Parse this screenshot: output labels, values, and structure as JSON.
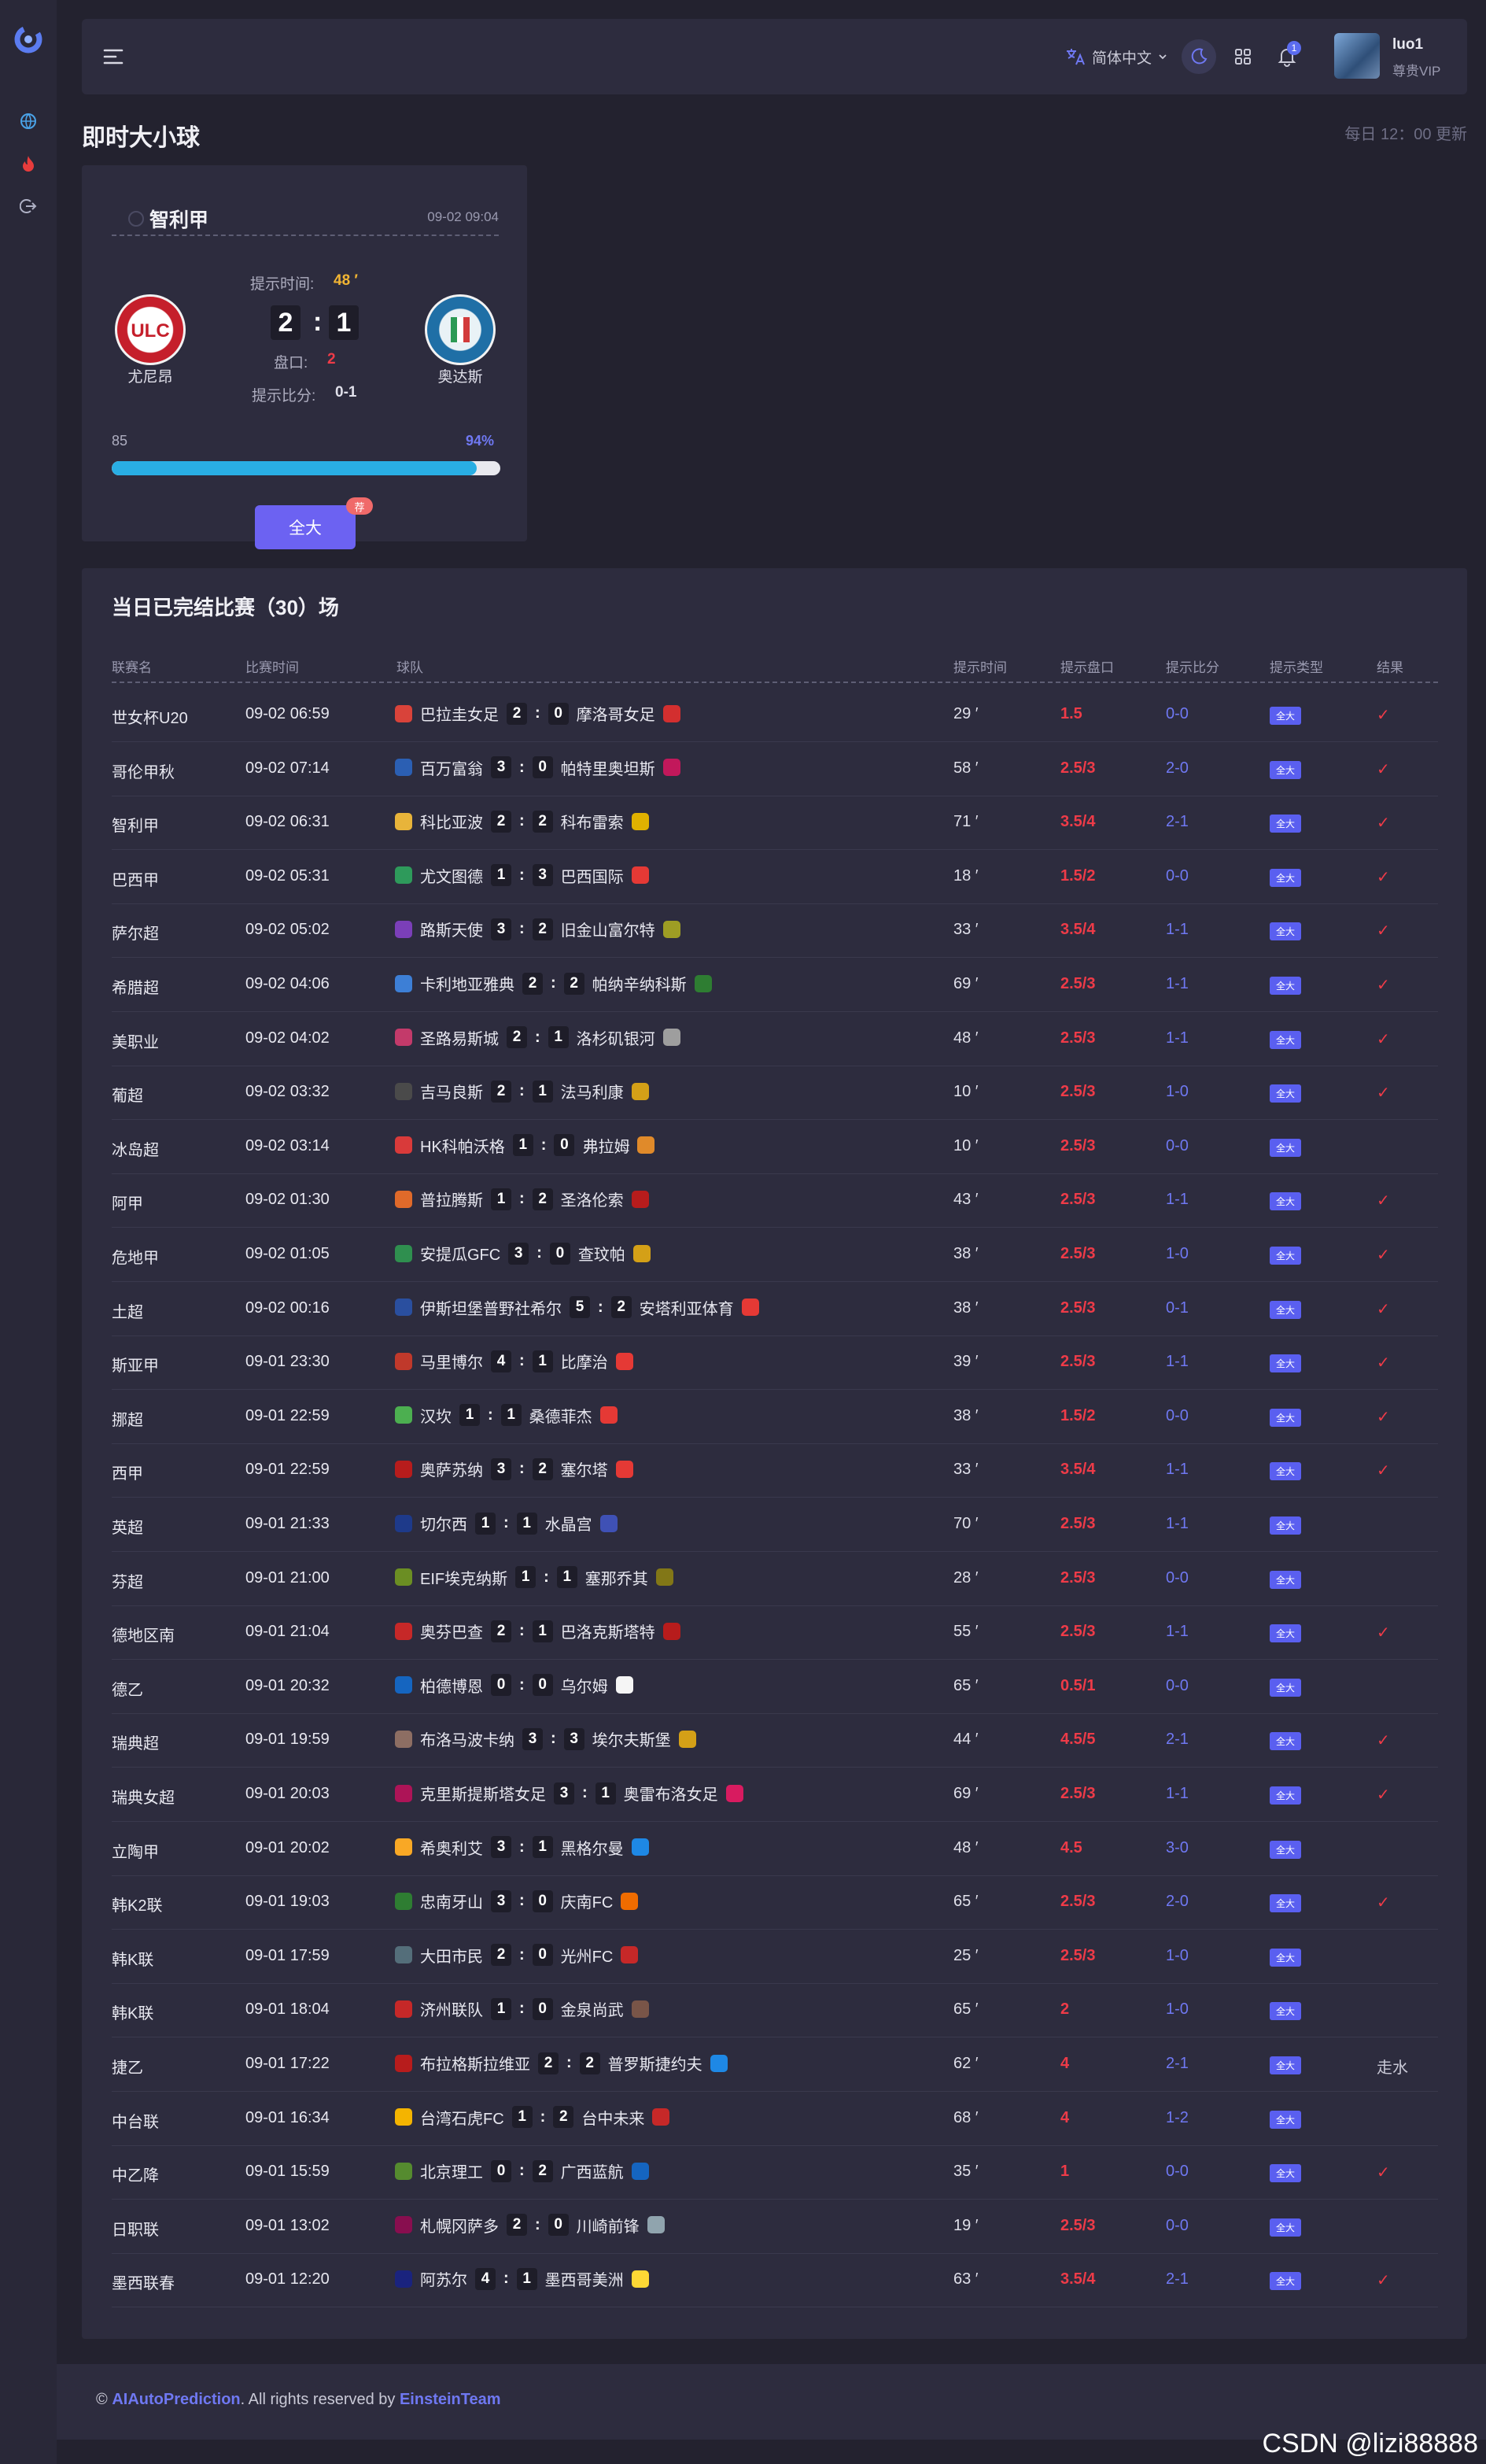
{
  "topbar": {
    "language": "简体中文",
    "notification_count": "1",
    "user_name": "luo1",
    "user_role": "尊贵VIP"
  },
  "page": {
    "title": "即时大小球",
    "update_note": "每日 12：00 更新"
  },
  "live_card": {
    "league": "智利甲",
    "datetime": "09-02 09:04",
    "home_team": "尤尼昂",
    "away_team": "奥达斯",
    "tip_time_label": "提示时间:",
    "tip_time_value": "48 ′",
    "home_score": "2",
    "away_score": "1",
    "handicap_label": "盘口:",
    "handicap_value": "2",
    "tip_score_label": "提示比分:",
    "tip_score_value": "0-1",
    "progress_left": "85",
    "progress_right": "94%",
    "progress_fraction": 0.94,
    "button_label": "全大",
    "badge_label": "荐"
  },
  "table": {
    "title": "当日已完结比赛（30）场",
    "headers": {
      "league": "联赛名",
      "time": "比赛时间",
      "teams": "球队",
      "tip_time": "提示时间",
      "tip_line": "提示盘口",
      "tip_score": "提示比分",
      "tip_type": "提示类型",
      "result": "结果"
    },
    "rows": [
      {
        "league": "世女杯U20",
        "time": "09-02 06:59",
        "home": "巴拉圭女足",
        "hs": "2",
        "as": "0",
        "away": "摩洛哥女足",
        "min": "29 ′",
        "line": "1.5",
        "tscore": "0-0",
        "type": "全大",
        "result": "✓"
      },
      {
        "league": "哥伦甲秋",
        "time": "09-02 07:14",
        "home": "百万富翁",
        "hs": "3",
        "as": "0",
        "away": "帕特里奥坦斯",
        "min": "58 ′",
        "line": "2.5/3",
        "tscore": "2-0",
        "type": "全大",
        "result": "✓"
      },
      {
        "league": "智利甲",
        "time": "09-02 06:31",
        "home": "科比亚波",
        "hs": "2",
        "as": "2",
        "away": "科布雷索",
        "min": "71 ′",
        "line": "3.5/4",
        "tscore": "2-1",
        "type": "全大",
        "result": "✓"
      },
      {
        "league": "巴西甲",
        "time": "09-02 05:31",
        "home": "尤文图德",
        "hs": "1",
        "as": "3",
        "away": "巴西国际",
        "min": "18 ′",
        "line": "1.5/2",
        "tscore": "0-0",
        "type": "全大",
        "result": "✓"
      },
      {
        "league": "萨尔超",
        "time": "09-02 05:02",
        "home": "路斯天使",
        "hs": "3",
        "as": "2",
        "away": "旧金山富尔特",
        "min": "33 ′",
        "line": "3.5/4",
        "tscore": "1-1",
        "type": "全大",
        "result": "✓"
      },
      {
        "league": "希腊超",
        "time": "09-02 04:06",
        "home": "卡利地亚雅典",
        "hs": "2",
        "as": "2",
        "away": "帕纳辛纳科斯",
        "min": "69 ′",
        "line": "2.5/3",
        "tscore": "1-1",
        "type": "全大",
        "result": "✓"
      },
      {
        "league": "美职业",
        "time": "09-02 04:02",
        "home": "圣路易斯城",
        "hs": "2",
        "as": "1",
        "away": "洛杉矶银河",
        "min": "48 ′",
        "line": "2.5/3",
        "tscore": "1-1",
        "type": "全大",
        "result": "✓"
      },
      {
        "league": "葡超",
        "time": "09-02 03:32",
        "home": "吉马良斯",
        "hs": "2",
        "as": "1",
        "away": "法马利康",
        "min": "10 ′",
        "line": "2.5/3",
        "tscore": "1-0",
        "type": "全大",
        "result": "✓"
      },
      {
        "league": "冰岛超",
        "time": "09-02 03:14",
        "home": "HK科帕沃格",
        "hs": "1",
        "as": "0",
        "away": "弗拉姆",
        "min": "10 ′",
        "line": "2.5/3",
        "tscore": "0-0",
        "type": "全大",
        "result": ""
      },
      {
        "league": "阿甲",
        "time": "09-02 01:30",
        "home": "普拉腾斯",
        "hs": "1",
        "as": "2",
        "away": "圣洛伦索",
        "min": "43 ′",
        "line": "2.5/3",
        "tscore": "1-1",
        "type": "全大",
        "result": "✓"
      },
      {
        "league": "危地甲",
        "time": "09-02 01:05",
        "home": "安提瓜GFC",
        "hs": "3",
        "as": "0",
        "away": "查玟帕",
        "min": "38 ′",
        "line": "2.5/3",
        "tscore": "1-0",
        "type": "全大",
        "result": "✓"
      },
      {
        "league": "土超",
        "time": "09-02 00:16",
        "home": "伊斯坦堡普野社希尔",
        "hs": "5",
        "as": "2",
        "away": "安塔利亚体育",
        "min": "38 ′",
        "line": "2.5/3",
        "tscore": "0-1",
        "type": "全大",
        "result": "✓"
      },
      {
        "league": "斯亚甲",
        "time": "09-01 23:30",
        "home": "马里博尔",
        "hs": "4",
        "as": "1",
        "away": "比摩治",
        "min": "39 ′",
        "line": "2.5/3",
        "tscore": "1-1",
        "type": "全大",
        "result": "✓"
      },
      {
        "league": "挪超",
        "time": "09-01 22:59",
        "home": "汉坎",
        "hs": "1",
        "as": "1",
        "away": "桑德菲杰",
        "min": "38 ′",
        "line": "1.5/2",
        "tscore": "0-0",
        "type": "全大",
        "result": "✓"
      },
      {
        "league": "西甲",
        "time": "09-01 22:59",
        "home": "奥萨苏纳",
        "hs": "3",
        "as": "2",
        "away": "塞尔塔",
        "min": "33 ′",
        "line": "3.5/4",
        "tscore": "1-1",
        "type": "全大",
        "result": "✓"
      },
      {
        "league": "英超",
        "time": "09-01 21:33",
        "home": "切尔西",
        "hs": "1",
        "as": "1",
        "away": "水晶宫",
        "min": "70 ′",
        "line": "2.5/3",
        "tscore": "1-1",
        "type": "全大",
        "result": ""
      },
      {
        "league": "芬超",
        "time": "09-01 21:00",
        "home": "EIF埃克纳斯",
        "hs": "1",
        "as": "1",
        "away": "塞那乔其",
        "min": "28 ′",
        "line": "2.5/3",
        "tscore": "0-0",
        "type": "全大",
        "result": ""
      },
      {
        "league": "德地区南",
        "time": "09-01 21:04",
        "home": "奥芬巴查",
        "hs": "2",
        "as": "1",
        "away": "巴洛克斯塔特",
        "min": "55 ′",
        "line": "2.5/3",
        "tscore": "1-1",
        "type": "全大",
        "result": "✓"
      },
      {
        "league": "德乙",
        "time": "09-01 20:32",
        "home": "柏德博恩",
        "hs": "0",
        "as": "0",
        "away": "乌尔姆",
        "min": "65 ′",
        "line": "0.5/1",
        "tscore": "0-0",
        "type": "全大",
        "result": ""
      },
      {
        "league": "瑞典超",
        "time": "09-01 19:59",
        "home": "布洛马波卡纳",
        "hs": "3",
        "as": "3",
        "away": "埃尔夫斯堡",
        "min": "44 ′",
        "line": "4.5/5",
        "tscore": "2-1",
        "type": "全大",
        "result": "✓"
      },
      {
        "league": "瑞典女超",
        "time": "09-01 20:03",
        "home": "克里斯提斯塔女足",
        "hs": "3",
        "as": "1",
        "away": "奥雷布洛女足",
        "min": "69 ′",
        "line": "2.5/3",
        "tscore": "1-1",
        "type": "全大",
        "result": "✓"
      },
      {
        "league": "立陶甲",
        "time": "09-01 20:02",
        "home": "希奥利艾",
        "hs": "3",
        "as": "1",
        "away": "黑格尔曼",
        "min": "48 ′",
        "line": "4.5",
        "tscore": "3-0",
        "type": "全大",
        "result": ""
      },
      {
        "league": "韩K2联",
        "time": "09-01 19:03",
        "home": "忠南牙山",
        "hs": "3",
        "as": "0",
        "away": "庆南FC",
        "min": "65 ′",
        "line": "2.5/3",
        "tscore": "2-0",
        "type": "全大",
        "result": "✓"
      },
      {
        "league": "韩K联",
        "time": "09-01 17:59",
        "home": "大田市民",
        "hs": "2",
        "as": "0",
        "away": "光州FC",
        "min": "25 ′",
        "line": "2.5/3",
        "tscore": "1-0",
        "type": "全大",
        "result": ""
      },
      {
        "league": "韩K联",
        "time": "09-01 18:04",
        "home": "济州联队",
        "hs": "1",
        "as": "0",
        "away": "金泉尚武",
        "min": "65 ′",
        "line": "2",
        "tscore": "1-0",
        "type": "全大",
        "result": ""
      },
      {
        "league": "捷乙",
        "time": "09-01 17:22",
        "home": "布拉格斯拉维亚",
        "hs": "2",
        "as": "2",
        "away": "普罗斯捷约夫",
        "min": "62 ′",
        "line": "4",
        "tscore": "2-1",
        "type": "全大",
        "result": "走水"
      },
      {
        "league": "中台联",
        "time": "09-01 16:34",
        "home": "台湾石虎FC",
        "hs": "1",
        "as": "2",
        "away": "台中未来",
        "min": "68 ′",
        "line": "4",
        "tscore": "1-2",
        "type": "全大",
        "result": ""
      },
      {
        "league": "中乙降",
        "time": "09-01 15:59",
        "home": "北京理工",
        "hs": "0",
        "as": "2",
        "away": "广西蓝航",
        "min": "35 ′",
        "line": "1",
        "tscore": "0-0",
        "type": "全大",
        "result": "✓"
      },
      {
        "league": "日职联",
        "time": "09-01 13:02",
        "home": "札幌冈萨多",
        "hs": "2",
        "as": "0",
        "away": "川崎前锋",
        "min": "19 ′",
        "line": "2.5/3",
        "tscore": "0-0",
        "type": "全大",
        "result": ""
      },
      {
        "league": "墨西联春",
        "time": "09-01 12:20",
        "home": "阿苏尔",
        "hs": "4",
        "as": "1",
        "away": "墨西哥美洲",
        "min": "63 ′",
        "line": "3.5/4",
        "tscore": "2-1",
        "type": "全大",
        "result": "✓"
      }
    ]
  },
  "footer": {
    "copyright": "©",
    "brand": "AIAutoPrediction",
    "middle": ". All rights reserved by",
    "team": "EinsteinTeam"
  },
  "watermark": "CSDN @lizi88888",
  "colors": {
    "accent": "#6c62f2",
    "line_red": "#ee3b48",
    "score_blue": "#6f78f2",
    "progress": "#29aee4"
  }
}
